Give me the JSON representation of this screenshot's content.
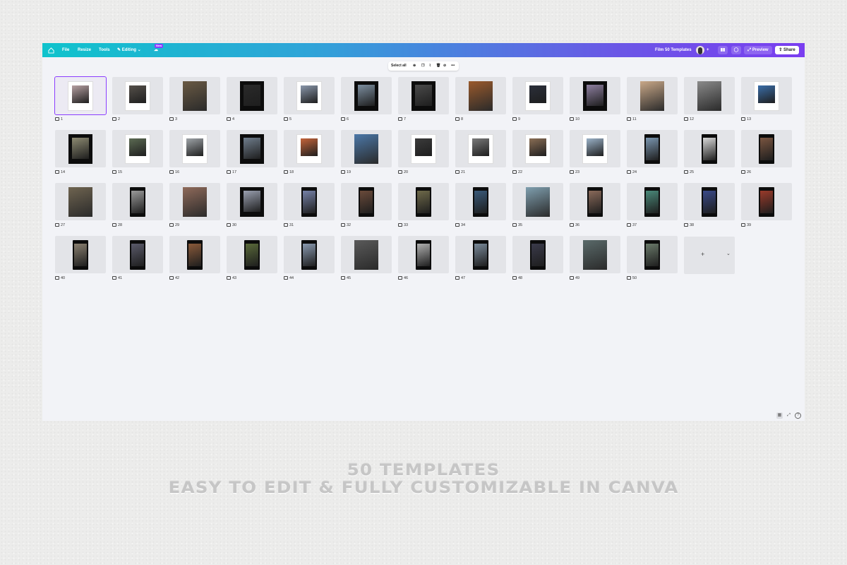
{
  "topbar": {
    "menu": [
      "File",
      "Resize",
      "Tools"
    ],
    "editing_label": "Editing",
    "new_badge": "New",
    "doc_title": "Film 50 Templates",
    "preview_label": "Preview",
    "share_label": "Share",
    "add_symbol": "+"
  },
  "toolbar": {
    "select_all": "Select all"
  },
  "add_page_symbol": "+",
  "pages": [
    {
      "n": "1",
      "type": "poster",
      "color": "#b6a0a2",
      "selected": true
    },
    {
      "n": "2",
      "type": "poster",
      "color": "#55504a"
    },
    {
      "n": "3",
      "type": "photo",
      "color": "#6a5a44"
    },
    {
      "n": "4",
      "type": "black",
      "color": "#2a2a2a"
    },
    {
      "n": "5",
      "type": "poster",
      "color": "#8a97aa"
    },
    {
      "n": "6",
      "type": "black",
      "color": "#7d8fa0"
    },
    {
      "n": "7",
      "type": "black",
      "color": "#4a4a4a"
    },
    {
      "n": "8",
      "type": "photo",
      "color": "#9a5a2c"
    },
    {
      "n": "9",
      "type": "poster",
      "color": "#2b2f3a"
    },
    {
      "n": "10",
      "type": "black",
      "color": "#8e7fa0"
    },
    {
      "n": "11",
      "type": "photo",
      "color": "#c9a888"
    },
    {
      "n": "12",
      "type": "photo",
      "color": "#8a8a8a"
    },
    {
      "n": "13",
      "type": "poster",
      "color": "#3b6ea8"
    },
    {
      "n": "14",
      "type": "black",
      "color": "#8d8a72"
    },
    {
      "n": "15",
      "type": "poster",
      "color": "#5c6b53"
    },
    {
      "n": "16",
      "type": "poster",
      "color": "#9fa4a8"
    },
    {
      "n": "17",
      "type": "black",
      "color": "#6f7d8c"
    },
    {
      "n": "18",
      "type": "poster",
      "color": "#c4643a"
    },
    {
      "n": "19",
      "type": "photo",
      "color": "#4c78a8"
    },
    {
      "n": "20",
      "type": "poster",
      "color": "#3b3b3b"
    },
    {
      "n": "21",
      "type": "poster",
      "color": "#7a7a7a"
    },
    {
      "n": "22",
      "type": "poster",
      "color": "#8a6e55"
    },
    {
      "n": "23",
      "type": "poster",
      "color": "#9bb2c8"
    },
    {
      "n": "24",
      "type": "story",
      "color": "#7a96b0"
    },
    {
      "n": "25",
      "type": "story",
      "color": "#d9d9d9"
    },
    {
      "n": "26",
      "type": "story",
      "color": "#7a5540"
    },
    {
      "n": "27",
      "type": "photo",
      "color": "#6f6450"
    },
    {
      "n": "28",
      "type": "story",
      "color": "#9a9a9a"
    },
    {
      "n": "29",
      "type": "photo",
      "color": "#8f6a5a"
    },
    {
      "n": "30",
      "type": "black",
      "color": "#9aa0b0"
    },
    {
      "n": "31",
      "type": "story",
      "color": "#7682a8"
    },
    {
      "n": "32",
      "type": "story",
      "color": "#6a4a3a"
    },
    {
      "n": "33",
      "type": "story",
      "color": "#6f6a4a"
    },
    {
      "n": "34",
      "type": "story",
      "color": "#3a5a7a"
    },
    {
      "n": "35",
      "type": "photo",
      "color": "#7f9faf"
    },
    {
      "n": "36",
      "type": "story",
      "color": "#8a6a5a"
    },
    {
      "n": "37",
      "type": "story",
      "color": "#4a8a7a"
    },
    {
      "n": "38",
      "type": "story",
      "color": "#3a4a8a"
    },
    {
      "n": "39",
      "type": "story",
      "color": "#9a3a2a"
    },
    {
      "n": "40",
      "type": "story",
      "color": "#8a8070"
    },
    {
      "n": "41",
      "type": "story",
      "color": "#5a5a6a"
    },
    {
      "n": "42",
      "type": "story",
      "color": "#8a5a3a"
    },
    {
      "n": "43",
      "type": "story",
      "color": "#5a6a3a"
    },
    {
      "n": "44",
      "type": "story",
      "color": "#8a9ab0"
    },
    {
      "n": "45",
      "type": "photo",
      "color": "#5a5a5a"
    },
    {
      "n": "46",
      "type": "story",
      "color": "#b0b0b0"
    },
    {
      "n": "47",
      "type": "story",
      "color": "#7a8a9a"
    },
    {
      "n": "48",
      "type": "story",
      "color": "#3a3a4a"
    },
    {
      "n": "49",
      "type": "photo",
      "color": "#5a6a6a"
    },
    {
      "n": "50",
      "type": "story",
      "color": "#6a7a6a"
    }
  ],
  "caption": {
    "line1": "50 TEMPLATES",
    "line2": "EASY TO EDIT & FULLY CUSTOMIZABLE IN CANVA"
  },
  "colors": {
    "accent": "#8b3dff",
    "gradient_start": "#0fc3cc",
    "gradient_end": "#7a3ef0"
  }
}
